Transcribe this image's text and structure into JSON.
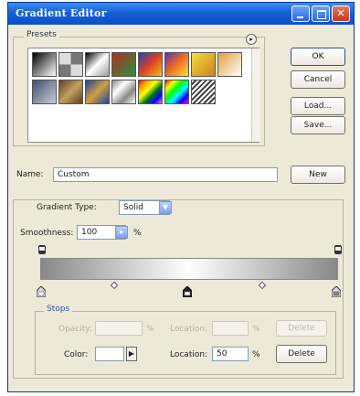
{
  "window": {
    "title": "Gradient Editor"
  },
  "presets": {
    "label": "Presets",
    "menu_icon": "circle-arrow-icon",
    "swatches_row1": [
      "linear-gradient(135deg,#000,#fff)",
      "repeating-conic-gradient(#777 0 25%, #ddd 0 50%)",
      "linear-gradient(135deg,#000,#fff 50%,#999)",
      "linear-gradient(135deg,#b03020,#2a9040)",
      "linear-gradient(135deg,#2040c0,#e04020,#f0c020)",
      "linear-gradient(135deg,#6030a0,#f07020,#f8e040)",
      "linear-gradient(135deg,#f0e040,#d08020)",
      "linear-gradient(135deg,#e0a040,#fff)"
    ],
    "swatches_row2": [
      "linear-gradient(135deg,#405070,#c8ccd4)",
      "linear-gradient(135deg,#604020,#c0a060,#604020)",
      "linear-gradient(135deg,#2040a0,#d0a040,#2040a0)",
      "linear-gradient(135deg,#888,#fff,#888,#fff)",
      "linear-gradient(135deg,red,orange,yellow,green,blue,violet)",
      "linear-gradient(135deg,red,yellow,lime,cyan,blue,magenta)",
      "repeating-linear-gradient(135deg,#fff 0 2px,#444 2px 4px)"
    ]
  },
  "buttons": {
    "ok": "OK",
    "cancel": "Cancel",
    "load": "Load...",
    "save": "Save...",
    "new": "New"
  },
  "name": {
    "label": "Name:",
    "value": "Custom"
  },
  "gradient": {
    "type_label": "Gradient Type:",
    "type_value": "Solid",
    "smoothness_label": "Smoothness:",
    "smoothness_value": "100",
    "smoothness_unit": "%",
    "bar_start_color": "#ffffff",
    "bar_end_color": "#888888"
  },
  "stops": {
    "label": "Stops",
    "opacity_label": "Opacity:",
    "opacity_unit": "%",
    "location_label": "Location:",
    "location_unit": "%",
    "delete_label": "Delete",
    "color_label": "Color:",
    "color_value_swatch": "#ffffff",
    "color_location_label": "Location:",
    "color_location_value": "50",
    "color_location_unit": "%",
    "color_delete_label": "Delete"
  }
}
